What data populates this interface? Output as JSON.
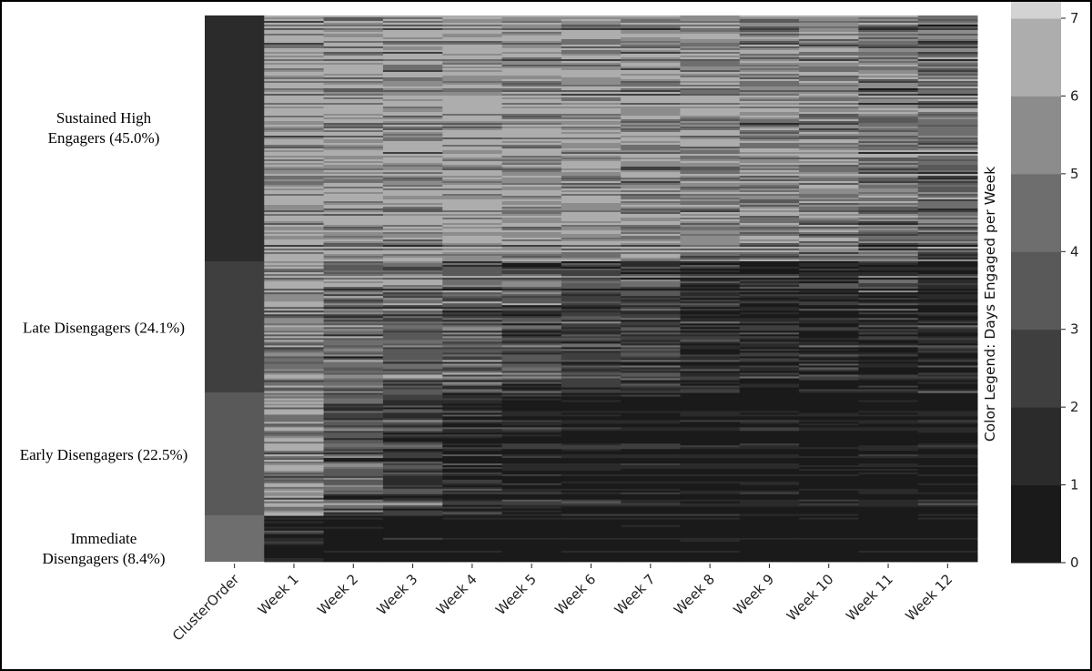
{
  "chart_data": {
    "type": "heatmap",
    "title": "",
    "xlabel": "",
    "ylabel": "",
    "columns": [
      "ClusterOrder",
      "Week 1",
      "Week 2",
      "Week 3",
      "Week 4",
      "Week 5",
      "Week 6",
      "Week 7",
      "Week 8",
      "Week 9",
      "Week 10",
      "Week 11",
      "Week 12"
    ],
    "clusters": [
      {
        "name": "Sustained High Engagers",
        "label_lines": [
          "Sustained High",
          "Engagers (45.0%)"
        ],
        "share_percent": 45.0,
        "cluster_order_value": 1,
        "mean_days_per_week": [
          6.3,
          6.1,
          6.0,
          6.1,
          5.9,
          5.8,
          5.6,
          5.5,
          5.3,
          5.1,
          4.8,
          4.2
        ]
      },
      {
        "name": "Late Disengagers",
        "label_lines": [
          "Late Disengagers (24.1%)"
        ],
        "share_percent": 24.1,
        "cluster_order_value": 2,
        "mean_days_per_week": [
          5.4,
          4.6,
          4.3,
          3.9,
          3.3,
          2.6,
          2.2,
          1.8,
          1.6,
          1.4,
          1.2,
          1.1
        ]
      },
      {
        "name": "Early Disengagers",
        "label_lines": [
          "Early Disengagers (22.5%)"
        ],
        "share_percent": 22.5,
        "cluster_order_value": 3,
        "mean_days_per_week": [
          5.2,
          3.2,
          2.0,
          1.3,
          0.8,
          0.5,
          0.4,
          0.3,
          0.3,
          0.2,
          0.2,
          0.2
        ]
      },
      {
        "name": "Immediate Disengagers",
        "label_lines": [
          "Immediate",
          "Disengagers (8.4%)"
        ],
        "share_percent": 8.4,
        "cluster_order_value": 4,
        "mean_days_per_week": [
          1.0,
          0.6,
          0.4,
          0.3,
          0.2,
          0.2,
          0.1,
          0.1,
          0.1,
          0.1,
          0.1,
          0.1
        ]
      }
    ],
    "colorbar": {
      "title": "Color Legend:  Days Engaged per Week",
      "range": [
        0,
        7
      ],
      "ticks": [
        0,
        1,
        2,
        3,
        4,
        5,
        6,
        7
      ],
      "tick_labels": [
        "0",
        "1",
        "2",
        "3",
        "4",
        "5",
        "6",
        "7"
      ],
      "band_colors": [
        "#1a1a1a",
        "#2b2b2b",
        "#3f3f3f",
        "#595959",
        "#6e6e6e",
        "#8c8c8c",
        "#adadad",
        "#d3d3d3"
      ],
      "placement": "right"
    },
    "grid": false,
    "legend": "right"
  }
}
